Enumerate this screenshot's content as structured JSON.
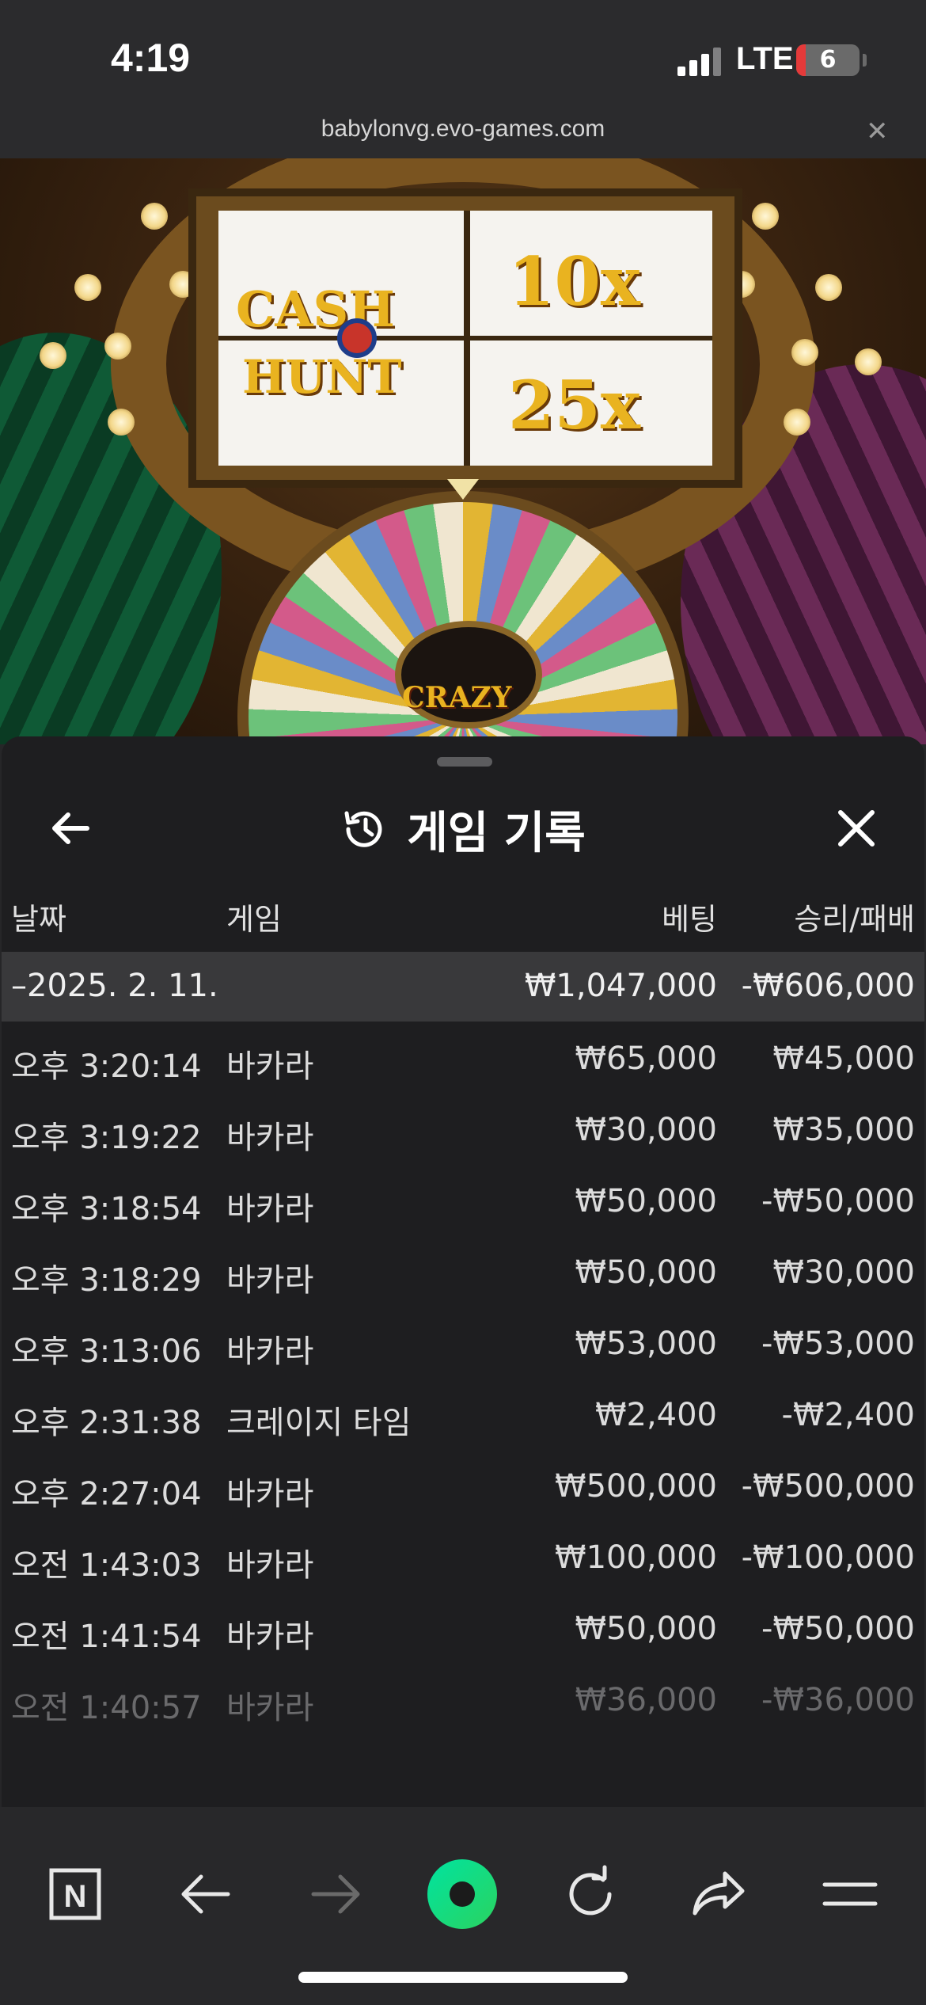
{
  "status_bar": {
    "time": "4:19",
    "network": "LTE",
    "battery": "6"
  },
  "browser": {
    "url": "babylonvg.evo-games.com",
    "close_icon": "close-icon"
  },
  "game_background": {
    "logo_left_line1": "CASH",
    "logo_left_line2": "HUNT",
    "multiplier_top": "10x",
    "multiplier_bottom": "25x",
    "wheel_logo": "CRAZY"
  },
  "panel": {
    "title": "게임 기록",
    "icons": {
      "back": "arrow-left-icon",
      "history": "history-icon",
      "close": "close-icon"
    },
    "columns": {
      "date": "날짜",
      "game": "게임",
      "bet": "베팅",
      "result": "승리/패배"
    },
    "summary": {
      "date": "–2025. 2. 11.",
      "bet": "₩1,047,000",
      "result": "-₩606,000"
    },
    "rows": [
      {
        "time": "오후 3:20:14",
        "game": "바카라",
        "bet": "₩65,000",
        "result": "₩45,000"
      },
      {
        "time": "오후 3:19:22",
        "game": "바카라",
        "bet": "₩30,000",
        "result": "₩35,000"
      },
      {
        "time": "오후 3:18:54",
        "game": "바카라",
        "bet": "₩50,000",
        "result": "-₩50,000"
      },
      {
        "time": "오후 3:18:29",
        "game": "바카라",
        "bet": "₩50,000",
        "result": "₩30,000"
      },
      {
        "time": "오후 3:13:06",
        "game": "바카라",
        "bet": "₩53,000",
        "result": "-₩53,000"
      },
      {
        "time": "오후 2:31:38",
        "game": "크레이지 타임",
        "bet": "₩2,400",
        "result": "-₩2,400"
      },
      {
        "time": "오후 2:27:04",
        "game": "바카라",
        "bet": "₩500,000",
        "result": "-₩500,000"
      },
      {
        "time": "오전 1:43:03",
        "game": "바카라",
        "bet": "₩100,000",
        "result": "-₩100,000"
      },
      {
        "time": "오전 1:41:54",
        "game": "바카라",
        "bet": "₩50,000",
        "result": "-₩50,000"
      },
      {
        "time": "오전 1:40:57",
        "game": "바카라",
        "bet": "₩36,000",
        "result": "-₩36,000"
      }
    ]
  },
  "toolbar": {
    "items": [
      "naver-n-icon",
      "back-arrow-icon",
      "forward-arrow-icon",
      "green-dot-home-icon",
      "reload-icon",
      "share-icon",
      "menu-icon"
    ],
    "brand_color": "#00d980",
    "n_letter": "N"
  }
}
